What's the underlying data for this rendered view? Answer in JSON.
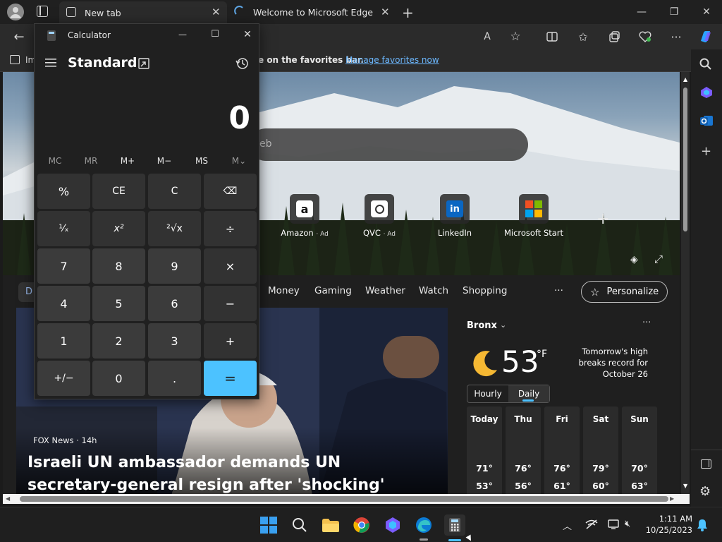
{
  "browser": {
    "tabs": [
      {
        "label": "New tab"
      },
      {
        "label": "Welcome to Microsoft Edge"
      }
    ],
    "favorites_hint": "e on the favorites bar.",
    "favorites_link": "Manage favorites now",
    "favbar_left_label": "Im"
  },
  "newtab": {
    "search_placeholder": "eb",
    "quick_links": [
      {
        "label": "Amazon",
        "ad": "· Ad"
      },
      {
        "label": "QVC",
        "ad": "· Ad"
      },
      {
        "label": "LinkedIn",
        "ad": ""
      },
      {
        "label": "Microsoft Start",
        "ad": ""
      }
    ],
    "feed_left_chip": "D",
    "feed_categories": [
      "Money",
      "Gaming",
      "Weather",
      "Watch",
      "Shopping"
    ],
    "more_label": "···",
    "personalize_label": "Personalize",
    "article": {
      "source": "FOX News · 14h",
      "headline": "Israeli UN ambassador demands UN secretary-general resign after 'shocking' speech"
    },
    "weather": {
      "location": "Bronx",
      "temp": "53",
      "unit": "°F",
      "note": "Tomorrow's high breaks record for October 26",
      "tabs": [
        "Hourly",
        "Daily"
      ],
      "days": [
        {
          "day": "Today",
          "high": "71°",
          "low": "53°"
        },
        {
          "day": "Thu",
          "high": "76°",
          "low": "56°"
        },
        {
          "day": "Fri",
          "high": "76°",
          "low": "61°"
        },
        {
          "day": "Sat",
          "high": "79°",
          "low": "60°"
        },
        {
          "day": "Sun",
          "high": "70°",
          "low": "63°"
        }
      ]
    }
  },
  "calculator": {
    "title": "Calculator",
    "mode": "Standard",
    "display": "0",
    "memory": [
      "MC",
      "MR",
      "M+",
      "M−",
      "MS",
      "M⌄"
    ],
    "keys": [
      [
        "%",
        "CE",
        "C",
        "⌫"
      ],
      [
        "¹⁄ₓ",
        "x²",
        "²√x",
        "÷"
      ],
      [
        "7",
        "8",
        "9",
        "×"
      ],
      [
        "4",
        "5",
        "6",
        "−"
      ],
      [
        "1",
        "2",
        "3",
        "+"
      ],
      [
        "+/−",
        "0",
        ".",
        "="
      ]
    ]
  },
  "taskbar": {
    "time": "1:11 AM",
    "date": "10/25/2023"
  }
}
